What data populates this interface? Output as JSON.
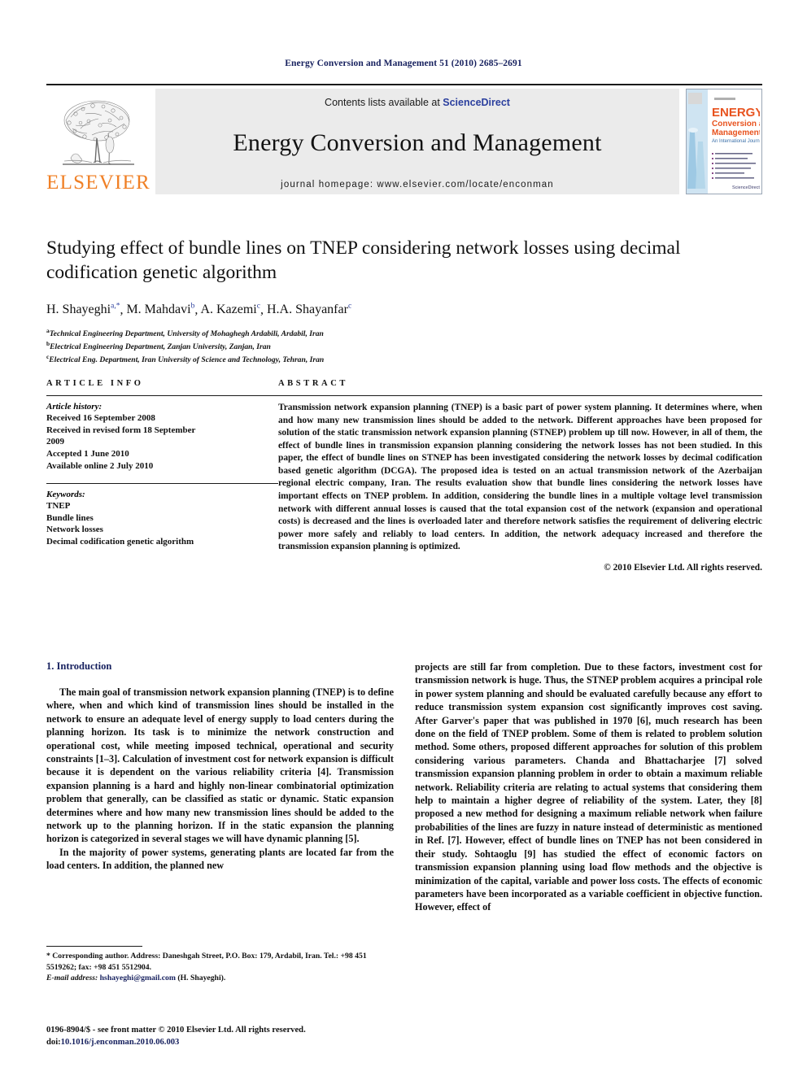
{
  "running_head": "Energy Conversion and Management 51 (2010) 2685–2691",
  "masthead": {
    "publisher": "ELSEVIER",
    "contents_prefix": "Contents lists available at ",
    "contents_link": "ScienceDirect",
    "journal_title": "Energy Conversion and Management",
    "homepage": "journal homepage: www.elsevier.com/locate/enconman",
    "cover": {
      "badge": "ENERGY",
      "line2": "Conversion and",
      "line3": "Management",
      "line4": "An International Journal",
      "logo": "ScienceDirect"
    }
  },
  "title": "Studying effect of bundle lines on TNEP considering network losses using decimal codification genetic algorithm",
  "authors": [
    {
      "name": "H. Shayeghi",
      "marks": "a,*"
    },
    {
      "name": "M. Mahdavi",
      "marks": "b"
    },
    {
      "name": "A. Kazemi",
      "marks": "c"
    },
    {
      "name": "H.A. Shayanfar",
      "marks": "c"
    }
  ],
  "affiliations": [
    {
      "mark": "a",
      "text": "Technical Engineering Department, University of Mohaghegh Ardabili, Ardabil, Iran"
    },
    {
      "mark": "b",
      "text": "Electrical Engineering Department, Zanjan University, Zanjan, Iran"
    },
    {
      "mark": "c",
      "text": "Electrical Eng. Department, Iran University of Science and Technology, Tehran, Iran"
    }
  ],
  "article_info": {
    "heading": "ARTICLE INFO",
    "history_title": "Article history:",
    "history_lines": [
      "Received 16 September 2008",
      "Received in revised form 18 September",
      "2009",
      "Accepted 1 June 2010",
      "Available online 2 July 2010"
    ],
    "keywords_title": "Keywords:",
    "keywords": [
      "TNEP",
      "Bundle lines",
      "Network losses",
      "Decimal codification genetic algorithm"
    ]
  },
  "abstract": {
    "heading": "ABSTRACT",
    "text": "Transmission network expansion planning (TNEP) is a basic part of power system planning. It determines where, when and how many new transmission lines should be added to the network. Different approaches have been proposed for solution of the static transmission network expansion planning (STNEP) problem up till now. However, in all of them, the effect of bundle lines in transmission expansion planning considering the network losses has not been studied. In this paper, the effect of bundle lines on STNEP has been investigated considering the network losses by decimal codification based genetic algorithm (DCGA). The proposed idea is tested on an actual transmission network of the Azerbaijan regional electric company, Iran. The results evaluation show that bundle lines considering the network losses have important effects on TNEP problem. In addition, considering the bundle lines in a multiple voltage level transmission network with different annual losses is caused that the total expansion cost of the network (expansion and operational costs) is decreased and the lines is overloaded later and therefore network satisfies the requirement of delivering electric power more safely and reliably to load centers. In addition, the network adequacy increased and therefore the transmission expansion planning is optimized.",
    "copyright": "© 2010 Elsevier Ltd. All rights reserved."
  },
  "introduction": {
    "heading": "1. Introduction",
    "left_paragraphs": [
      "The main goal of transmission network expansion planning (TNEP) is to define where, when and which kind of transmission lines should be installed in the network to ensure an adequate level of energy supply to load centers during the planning horizon. Its task is to minimize the network construction and operational cost, while meeting imposed technical, operational and security constraints [1–3]. Calculation of investment cost for network expansion is difficult because it is dependent on the various reliability criteria [4]. Transmission expansion planning is a hard and highly non-linear combinatorial optimization problem that generally, can be classified as static or dynamic. Static expansion determines where and how many new transmission lines should be added to the network up to the planning horizon. If in the static expansion the planning horizon is categorized in several stages we will have dynamic planning [5].",
      "In the majority of power systems, generating plants are located far from the load centers. In addition, the planned new"
    ],
    "right_paragraphs": [
      "projects are still far from completion. Due to these factors, investment cost for transmission network is huge. Thus, the STNEP problem acquires a principal role in power system planning and should be evaluated carefully because any effort to reduce transmission system expansion cost significantly improves cost saving. After Garver's paper that was published in 1970 [6], much research has been done on the field of TNEP problem. Some of them is related to problem solution method. Some others, proposed different approaches for solution of this problem considering various parameters. Chanda and Bhattacharjee [7] solved transmission expansion planning problem in order to obtain a maximum reliable network. Reliability criteria are relating to actual systems that considering them help to maintain a higher degree of reliability of the system. Later, they [8] proposed a new method for designing a maximum reliable network when failure probabilities of the lines are fuzzy in nature instead of deterministic as mentioned in Ref. [7]. However, effect of bundle lines on TNEP has not been considered in their study. Sohtaoglu [9] has studied the effect of economic factors on transmission expansion planning using load flow methods and the objective is minimization of the capital, variable and power loss costs. The effects of economic parameters have been incorporated as a variable coefficient in objective function. However, effect of"
    ]
  },
  "footnote": {
    "corresponding": "* Corresponding author. Address: Daneshgah Street, P.O. Box: 179, Ardabil, Iran. Tel.: +98 451 5519262; fax: +98 451 5512904.",
    "email_label": "E-mail address:",
    "email": "hshayeghi@gmail.com",
    "email_owner": "(H. Shayeghi)."
  },
  "issn_footer": {
    "line1": "0196-8904/$ - see front matter © 2010 Elsevier Ltd. All rights reserved.",
    "doi_label": "doi:",
    "doi_value": "10.1016/j.enconman.2010.06.003"
  },
  "colors": {
    "running_head": "#16205e",
    "elsevier_orange": "#f08026",
    "sciencedirect_blue": "#2b3f9e",
    "link_navy": "#16205e",
    "band_gray": "#ebebeb"
  }
}
